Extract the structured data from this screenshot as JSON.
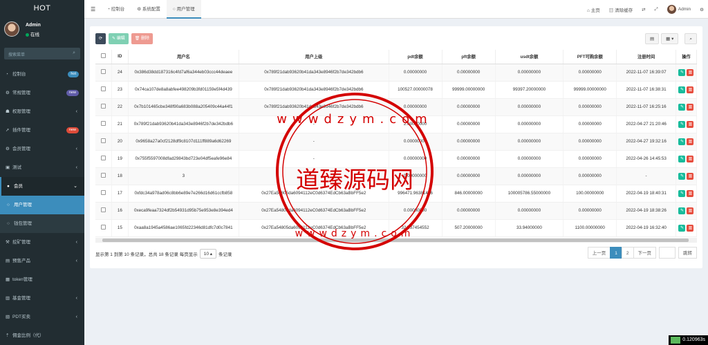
{
  "app": {
    "title": "HOT",
    "user": "Admin",
    "status": "在线",
    "search_placeholder": "搜索菜单"
  },
  "menu": [
    {
      "icon": "dashboard-icon",
      "glyph": "◔",
      "label": "控制台",
      "badge": "hot",
      "badge_color": "#3c8dbc"
    },
    {
      "icon": "settings-icon",
      "glyph": "⚙",
      "label": "常规管理",
      "badge": "new",
      "badge_color": "#605ca8"
    },
    {
      "icon": "users-icon",
      "glyph": "☗",
      "label": "权限管理",
      "chev": "‹"
    },
    {
      "icon": "rocket-icon",
      "glyph": "➚",
      "label": "插件管理",
      "badge": "new",
      "badge_color": "#dd4b39"
    },
    {
      "icon": "gear-icon",
      "glyph": "⚙",
      "label": "会员管理",
      "chev": "‹"
    },
    {
      "icon": "folder-icon",
      "glyph": "▣",
      "label": "测试",
      "chev": "‹"
    },
    {
      "icon": "user-icon",
      "glyph": "●",
      "label": "会员",
      "chev": "⌄",
      "active": true
    },
    {
      "icon": "circle-icon",
      "glyph": "○",
      "label": "用户管理",
      "sub": true,
      "on": true
    },
    {
      "icon": "circle-icon",
      "glyph": "○",
      "label": "钱包管理",
      "sub": true
    },
    {
      "icon": "pickaxe-icon",
      "glyph": "⚒",
      "label": "挖矿管理",
      "chev": "‹"
    },
    {
      "icon": "gift-icon",
      "glyph": "▤",
      "label": "预售产品",
      "chev": "‹"
    },
    {
      "icon": "circle-icon",
      "glyph": "▦",
      "label": "token管理"
    },
    {
      "icon": "bank-icon",
      "glyph": "▥",
      "label": "基金管理",
      "chev": "‹"
    },
    {
      "icon": "exchange-icon",
      "glyph": "▧",
      "label": "PDT买卖",
      "chev": "‹"
    },
    {
      "icon": "percent-icon",
      "glyph": "⇡",
      "label": "佣金比例（代）"
    }
  ],
  "header": {
    "tabs": [
      {
        "glyph": "◔",
        "label": "控制台"
      },
      {
        "glyph": "⚙",
        "label": "系统配置"
      },
      {
        "glyph": "○",
        "label": "用户管理"
      }
    ],
    "right": {
      "home": "主页",
      "clear": "清除缓存",
      "user": "Admin"
    }
  },
  "toolbar": {
    "edit": "编辑",
    "delete": "删除"
  },
  "table": {
    "headers": [
      "ID",
      "用户名",
      "用户上级",
      "pdt余额",
      "pft余额",
      "usdt余额",
      "PFT可购余额",
      "注册时间",
      "操作"
    ],
    "rows": [
      [
        "24",
        "0x386d38dd187316c4fd7af6a344eb03ccc44deaee",
        "0x789f21dab93620b41da343e8946f2b7de342bdb6",
        "0.00000000",
        "0.00000000",
        "0.00000000",
        "0.00000000",
        "2022-11-07 16:39:07"
      ],
      [
        "23",
        "0x74ca107de8a8abfee498209b3fd01159e5f4d439",
        "0x789f21dab93620b41da343e8946f2b7de342bdb6",
        "100527.00000078",
        "99999.00000000",
        "99397.20000000",
        "99999.00000000",
        "2022-11-07 16:38:31"
      ],
      [
        "22",
        "0x7b101465cbe348f90a683b088a205409c44a44f1",
        "0x789f21dab93620b41da343e8946f2b7de342bdb6",
        "0.00000000",
        "0.00000000",
        "0.00000000",
        "0.00000000",
        "2022-11-07 16:25:16"
      ],
      [
        "21",
        "0x789f21dab93620b41da343e8946f2b7de342bdb6",
        "-",
        "2.00000000",
        "0.00000000",
        "0.00000000",
        "0.00000000",
        "2022-04-27 21:20:46"
      ],
      [
        "20",
        "0x9658a27a0cf2128df9c8107d111ff889a6d62269",
        "-",
        "0.00000000",
        "0.00000000",
        "0.00000000",
        "0.00000000",
        "2022-04-27 19:32:16"
      ],
      [
        "19",
        "0x755f5597008dfad29843bd723e04df5eafe96e84",
        "-",
        "0.00000000",
        "0.00000000",
        "0.00000000",
        "0.00000000",
        "2022-04-26 14:45:53"
      ],
      [
        "18",
        "3",
        "-",
        "0.00000000",
        "0.00000000",
        "0.00000000",
        "0.00000000",
        "-"
      ],
      [
        "17",
        "0xfdc34a978ad06c8bb6e89e7e266d16d61ccfb858",
        "0x27Ea54805da6094112eC0d6374EdCb63aBbFF5e2",
        "996471.96381426",
        "846.00000000",
        "100005786.55000000",
        "100.00000000",
        "2022-04-19 18:40:31"
      ],
      [
        "16",
        "0xeca9feaa7324df2b54931d95b75e953e8e394ed4",
        "0x27Ea54805da6094112eC0d6374EdCb63aBbFF5e2",
        "0.00000000",
        "0.00000000",
        "0.00000000",
        "0.00000000",
        "2022-04-19 18:38:26"
      ],
      [
        "15",
        "0xaa8a1945a4586ae1065fd22346d81dfc7d0c7841",
        "0x27Ea54805da6094112eC0d6374EdCb63aBbFF5e2",
        "324.37454552",
        "507.20000000",
        "33.94000000",
        "1100.00000000",
        "2022-04-19 16:32:40"
      ]
    ]
  },
  "footer": {
    "info": "显示第 1 到第 10 条记录，总共 18 条记录 每页显示",
    "per_page": "10 ▴",
    "suffix": "条记录",
    "prev": "上一页",
    "pages": [
      "1",
      "2"
    ],
    "next": "下一页",
    "jump": "跳转"
  },
  "watermark": {
    "text": "道臻源码网",
    "letters": "wwwdzym.com"
  },
  "timer": "0.120963s"
}
